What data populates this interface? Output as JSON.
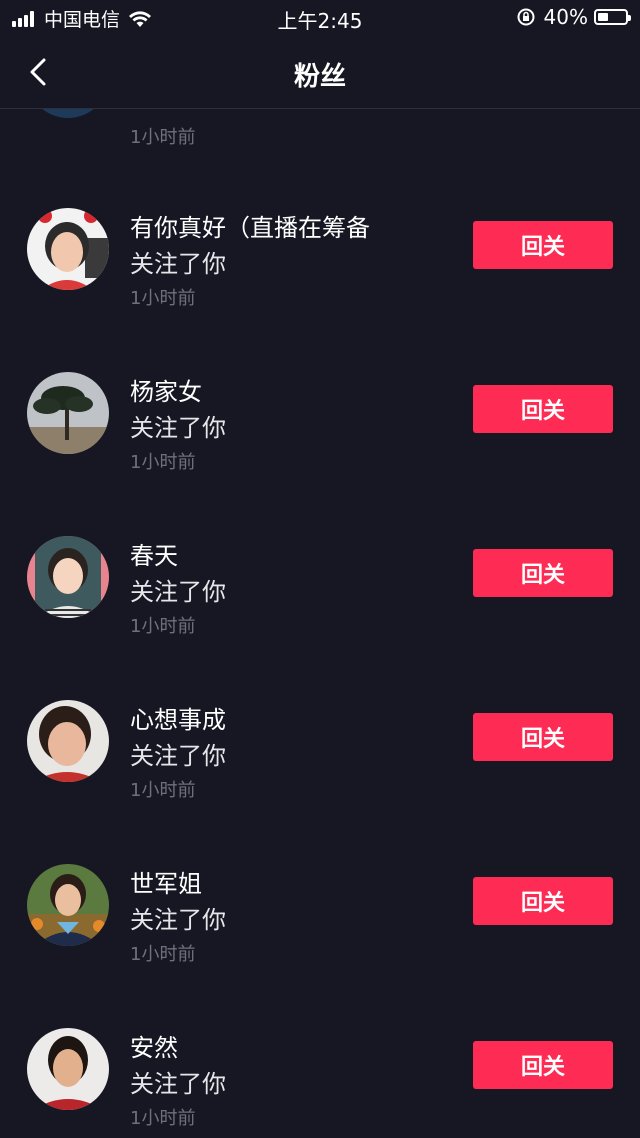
{
  "status_bar": {
    "carrier": "中国电信",
    "time": "上午2:45",
    "battery_percent": "40%",
    "battery_level": 0.4
  },
  "nav": {
    "title": "粉丝"
  },
  "partial_row": {
    "time": "1小时前"
  },
  "followers": [
    {
      "name": "有你真好（直播在筹备",
      "desc": "关注了你",
      "time": "1小时前",
      "button": "回关"
    },
    {
      "name": "杨家女",
      "desc": "关注了你",
      "time": "1小时前",
      "button": "回关"
    },
    {
      "name": "春天",
      "desc": "关注了你",
      "time": "1小时前",
      "button": "回关"
    },
    {
      "name": "心想事成",
      "desc": "关注了你",
      "time": "1小时前",
      "button": "回关"
    },
    {
      "name": "世军姐",
      "desc": "关注了你",
      "time": "1小时前",
      "button": "回关"
    },
    {
      "name": "安然",
      "desc": "关注了你",
      "time": "1小时前",
      "button": "回关"
    }
  ],
  "colors": {
    "background": "#161723",
    "accent": "#fe2c55",
    "secondary_text": "#6f707b"
  }
}
